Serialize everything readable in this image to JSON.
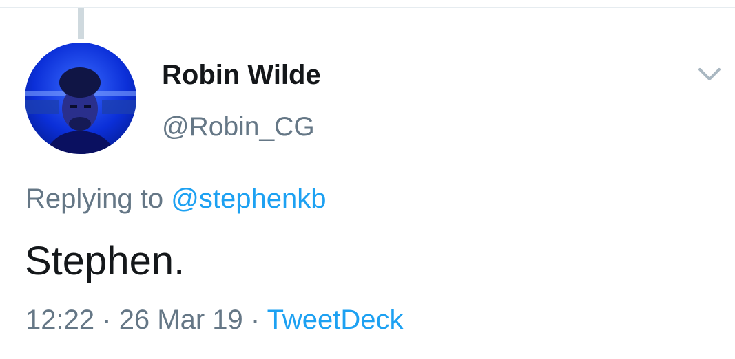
{
  "tweet": {
    "author": {
      "display_name": "Robin Wilde",
      "handle": "@Robin_CG",
      "avatar_icon": "profile-photo"
    },
    "menu_icon": "chevron-down-icon",
    "reply": {
      "prefix": "Replying to",
      "mention": "@stephenkb"
    },
    "text": "Stephen.",
    "meta": {
      "time": "12:22",
      "separator": "·",
      "date": "26 Mar 19",
      "source": "TweetDeck"
    }
  },
  "colors": {
    "primary_text": "#14171a",
    "secondary_text": "#657786",
    "link": "#1da1f2",
    "divider": "#e6ecf0",
    "thread_line": "#cfd9de"
  }
}
